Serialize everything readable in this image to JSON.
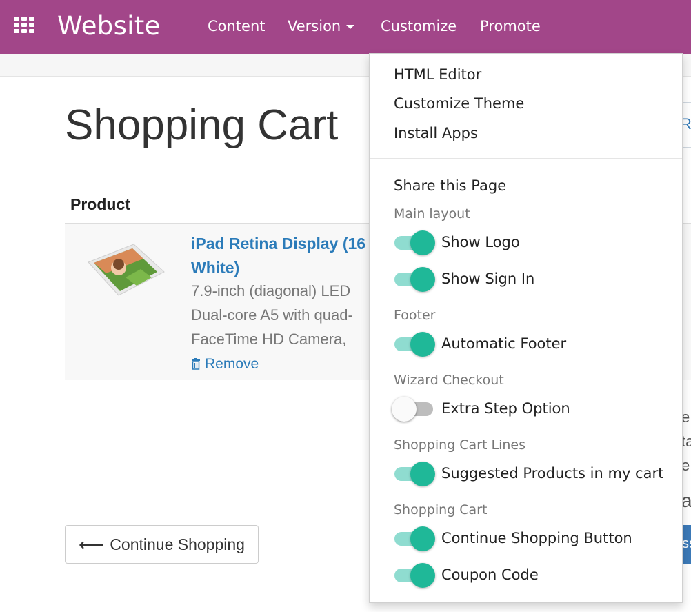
{
  "navbar": {
    "brand": "Website",
    "items": [
      {
        "label": "Content"
      },
      {
        "label": "Version"
      },
      {
        "label": "Customize"
      },
      {
        "label": "Promote"
      }
    ]
  },
  "page": {
    "title": "Shopping Cart",
    "table_header": "Product",
    "product": {
      "name_lines": [
        "iPad Retina Display (16",
        "White)"
      ],
      "description_lines": [
        "7.9-inch (diagonal) LED",
        "Dual-core A5 with quad-",
        "FaceTime HD Camera,"
      ],
      "remove_label": "Remove"
    },
    "continue_button": "Continue Shopping",
    "edge_fragments": [
      "R",
      "e",
      "ta",
      "e",
      "a",
      "ss"
    ]
  },
  "dropdown": {
    "top_items": [
      "HTML Editor",
      "Customize Theme",
      "Install Apps"
    ],
    "share": "Share this Page",
    "sections": [
      {
        "header": "Main layout",
        "options": [
          {
            "label": "Show Logo",
            "enabled": true
          },
          {
            "label": "Show Sign In",
            "enabled": true
          }
        ]
      },
      {
        "header": "Footer",
        "options": [
          {
            "label": "Automatic Footer",
            "enabled": true
          }
        ]
      },
      {
        "header": "Wizard Checkout",
        "options": [
          {
            "label": "Extra Step Option",
            "enabled": false
          }
        ]
      },
      {
        "header": "Shopping Cart Lines",
        "options": [
          {
            "label": "Suggested Products in my cart",
            "enabled": true
          }
        ]
      },
      {
        "header": "Shopping Cart",
        "options": [
          {
            "label": "Continue Shopping Button",
            "enabled": true
          },
          {
            "label": "Coupon Code",
            "enabled": true
          }
        ]
      }
    ]
  },
  "colors": {
    "navbar": "#a24689",
    "toggle_on": "#1fb898",
    "toggle_track_on": "#8fdcd0",
    "link": "#2b7bb9"
  },
  "icons": [
    "apps-grid-icon",
    "caret-down-icon",
    "trash-icon",
    "arrow-left-icon"
  ]
}
